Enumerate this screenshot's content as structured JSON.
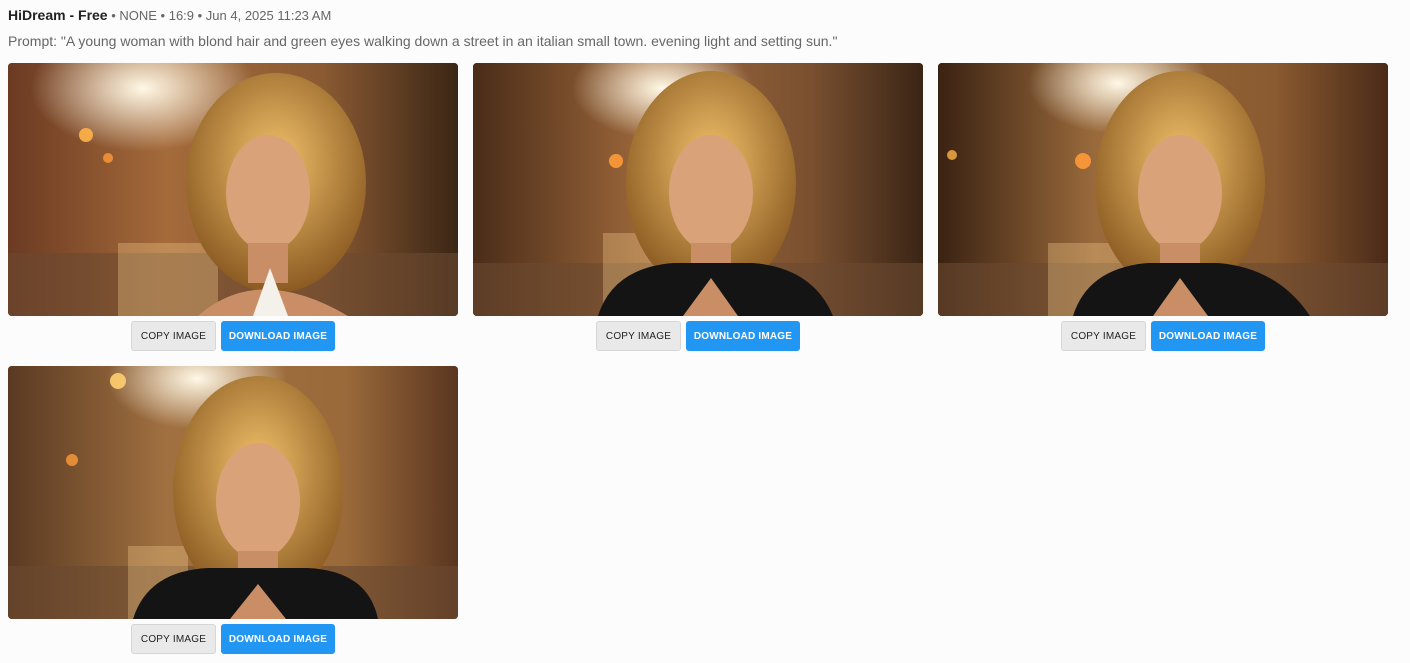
{
  "header": {
    "model": "HiDream - Free",
    "meta": "• NONE  • 16:9 • Jun 4, 2025 11:23 AM"
  },
  "prompt": "Prompt: \"A young woman with blond hair and green eyes walking down a street in an italian small town. evening light and setting sun.\"",
  "images": [
    {
      "copy_label": "COPY IMAGE",
      "download_label": "DOWNLOAD IMAGE",
      "outfit": "white-top"
    },
    {
      "copy_label": "COPY IMAGE",
      "download_label": "DOWNLOAD IMAGE",
      "outfit": "black-jacket"
    },
    {
      "copy_label": "COPY IMAGE",
      "download_label": "DOWNLOAD IMAGE",
      "outfit": "black-jacket"
    },
    {
      "copy_label": "COPY IMAGE",
      "download_label": "DOWNLOAD IMAGE",
      "outfit": "black-jacket"
    }
  ],
  "colors": {
    "download_button": "#2196f3",
    "copy_button": "#e9e9e9"
  }
}
